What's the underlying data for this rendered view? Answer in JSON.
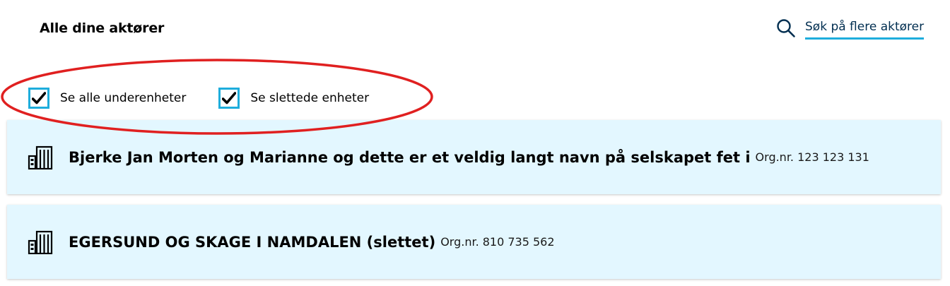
{
  "header": {
    "title": "Alle dine aktører",
    "search_link_label": "Søk på flere aktører"
  },
  "filters": [
    {
      "label": "Se alle underenheter",
      "checked": true
    },
    {
      "label": "Se slettede enheter",
      "checked": true
    }
  ],
  "actors": [
    {
      "name": "Bjerke Jan Morten og Marianne og dette er et veldig langt navn på selskapet fet i",
      "org_nr": "Org.nr. 123 123 131",
      "icon": "building-icon"
    },
    {
      "name": "EGERSUND OG SKAGE I NAMDALEN (slettet)",
      "org_nr": "Org.nr. 810 735 562",
      "icon": "building-icon"
    }
  ],
  "colors": {
    "accent_blue": "#1eaddc",
    "card_background": "#e3f7ff",
    "annotation_red": "#e02020",
    "link_text": "#022f51"
  }
}
